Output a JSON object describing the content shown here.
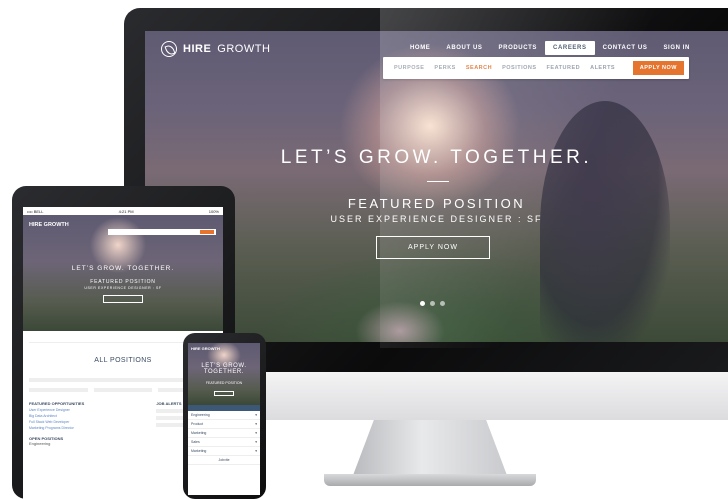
{
  "desktop": {
    "logo": {
      "brand_bold": "HIRE",
      "brand_thin": "GROWTH"
    },
    "nav": [
      "HOME",
      "ABOUT US",
      "PRODUCTS",
      "CAREERS",
      "CONTACT US",
      "SIGN IN"
    ],
    "nav_active": "CAREERS",
    "subnav": [
      "PURPOSE",
      "PERKS",
      "SEARCH",
      "POSITIONS",
      "FEATURED",
      "ALERTS"
    ],
    "subnav_active": "SEARCH",
    "apply_label": "APPLY NOW",
    "hero": {
      "title": "LET’S GROW. TOGETHER.",
      "featured": "FEATURED POSITION",
      "position": "USER EXPERIENCE DESIGNER : SF",
      "button": "APPLY NOW"
    },
    "carousel": {
      "count": 3,
      "active": 1
    }
  },
  "tablet": {
    "status": {
      "carrier": "•••• BELL",
      "time": "4:21 PM",
      "battery": "100%"
    },
    "logo": "HIRE GROWTH",
    "hero": {
      "title": "LET’S GROW. TOGETHER.",
      "featured": "FEATURED POSITION",
      "position": "USER EXPERIENCE DESIGNER : SF"
    },
    "section_title": "ALL POSITIONS",
    "featured_heading": "FEATURED OPPORTUNITIES",
    "featured_links": [
      "User Experience Designer",
      "Big Data Architect",
      "Full Stack Web Developer",
      "Marketing Programs Director"
    ],
    "alerts_heading": "JOB ALERTS",
    "open_heading": "OPEN POSITIONS",
    "open_first": "Engineering"
  },
  "phone": {
    "logo": "HIRE GROWTH",
    "hero": {
      "title_line1": "LET’S GROW.",
      "title_line2": "TOGETHER.",
      "featured": "FEATURED POSITION"
    },
    "categories": [
      "Engineering",
      "Product",
      "Marketing",
      "Sales",
      "Marketing"
    ],
    "footer": "Jobvite"
  }
}
